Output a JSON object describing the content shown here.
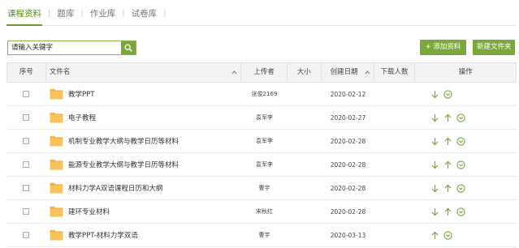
{
  "tabs": [
    {
      "label": "课程资料",
      "active": true
    },
    {
      "label": "题库",
      "active": false
    },
    {
      "label": "作业库",
      "active": false
    },
    {
      "label": "试卷库",
      "active": false
    }
  ],
  "search": {
    "placeholder": "请输入关键字",
    "icon": "search-icon"
  },
  "toolbar": {
    "add_label": "+ 添加资料",
    "new_folder_label": "新建文件夹"
  },
  "table": {
    "headers": {
      "index": "序号",
      "name": "文件名",
      "uploader": "上传者",
      "size": "大小",
      "date": "创建日期",
      "downloads": "下载人数",
      "actions": "操作"
    },
    "rows": [
      {
        "name": "教学PPT",
        "uploader": "张俊2169",
        "date": "2020-02-12",
        "actions": [
          "download",
          "more"
        ]
      },
      {
        "name": "电子教程",
        "uploader": "袁军李",
        "date": "2020-02-27",
        "actions": [
          "download",
          "up",
          "more"
        ]
      },
      {
        "name": "机制专业教学大纲与教学日历等材料",
        "uploader": "袁军李",
        "date": "2020-02-28",
        "actions": [
          "download",
          "up",
          "more"
        ]
      },
      {
        "name": "能源专业教学大纲与教学日历等材料",
        "uploader": "袁军李",
        "date": "2020-02-28",
        "actions": [
          "download",
          "up",
          "more"
        ]
      },
      {
        "name": "材料力学A双语课程日历和大纲",
        "uploader": "曹宇",
        "date": "2020-02-28",
        "actions": [
          "download",
          "up",
          "more"
        ]
      },
      {
        "name": "建环专业材料",
        "uploader": "宋秋红",
        "date": "2020-02-28",
        "actions": [
          "download",
          "up",
          "more"
        ]
      },
      {
        "name": "教学PPT-材料力学双语",
        "uploader": "曹宇",
        "date": "2020-03-13",
        "actions": [
          "up",
          "more"
        ]
      }
    ]
  },
  "colors": {
    "accent": "#7ca73d",
    "accent_dark": "#5a8a1f",
    "folder": "#f2b54a",
    "header_bg": "#f3f3f3"
  }
}
